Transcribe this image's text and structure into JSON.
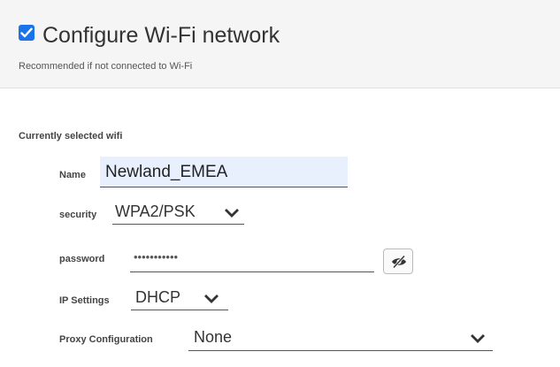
{
  "header": {
    "checkbox_checked": true,
    "title": "Configure Wi-Fi network",
    "subtitle": "Recommended if not connected to Wi-Fi"
  },
  "section": {
    "label": "Currently selected wifi"
  },
  "fields": {
    "name": {
      "label": "Name",
      "value": "Newland_EMEA"
    },
    "security": {
      "label": "security",
      "value": "WPA2/PSK",
      "icon": "chevron-down-icon"
    },
    "password": {
      "label": "password",
      "value": "•••••••••••",
      "toggle_icon": "eye-slash-icon"
    },
    "ip_settings": {
      "label": "IP Settings",
      "value": "DHCP",
      "icon": "chevron-down-icon"
    },
    "proxy": {
      "label": "Proxy Configuration",
      "value": "None",
      "icon": "chevron-down-icon"
    }
  },
  "colors": {
    "accent": "#1a73e8",
    "header_bg": "#f5f5f5",
    "field_highlight": "#e8f0fe"
  }
}
